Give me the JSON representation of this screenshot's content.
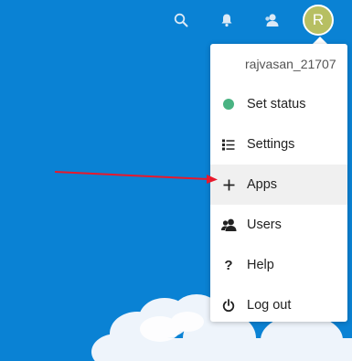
{
  "header": {
    "icons": [
      "search-icon",
      "notifications-icon",
      "contacts-icon"
    ],
    "avatar_initial": "R",
    "avatar_color": "#b7bf62"
  },
  "menu": {
    "username": "rajvasan_21707",
    "items": [
      {
        "label": "Set status",
        "icon": "status-dot-icon",
        "status_color": "#49b382"
      },
      {
        "label": "Settings",
        "icon": "settings-list-icon"
      },
      {
        "label": "Apps",
        "icon": "plus-icon",
        "highlighted": true
      },
      {
        "label": "Users",
        "icon": "users-icon"
      },
      {
        "label": "Help",
        "icon": "question-icon"
      },
      {
        "label": "Log out",
        "icon": "power-icon"
      }
    ]
  },
  "colors": {
    "background": "#0a82d4",
    "annotation_arrow": "#e8192c"
  }
}
